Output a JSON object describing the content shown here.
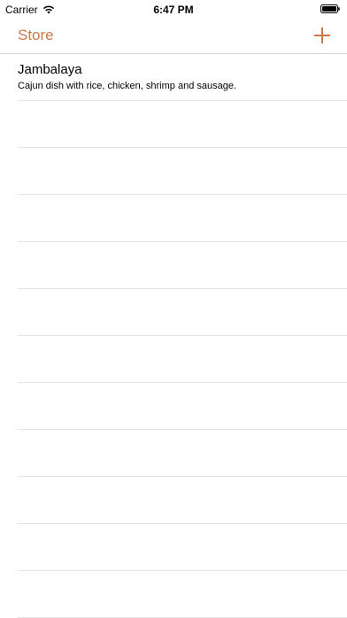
{
  "status_bar": {
    "carrier": "Carrier",
    "time": "6:47 PM",
    "wifi_icon": "wifi-icon",
    "battery_icon": "battery-icon"
  },
  "nav": {
    "title": "Store",
    "add_icon": "plus-icon"
  },
  "colors": {
    "accent": "#c87a4a"
  },
  "items": [
    {
      "title": "Jambalaya",
      "subtitle": "Cajun dish with rice, chicken, shrimp and sausage."
    },
    {
      "title": "",
      "subtitle": ""
    },
    {
      "title": "",
      "subtitle": ""
    },
    {
      "title": "",
      "subtitle": ""
    },
    {
      "title": "",
      "subtitle": ""
    },
    {
      "title": "",
      "subtitle": ""
    },
    {
      "title": "",
      "subtitle": ""
    },
    {
      "title": "",
      "subtitle": ""
    },
    {
      "title": "",
      "subtitle": ""
    },
    {
      "title": "",
      "subtitle": ""
    },
    {
      "title": "",
      "subtitle": ""
    },
    {
      "title": "",
      "subtitle": ""
    }
  ]
}
